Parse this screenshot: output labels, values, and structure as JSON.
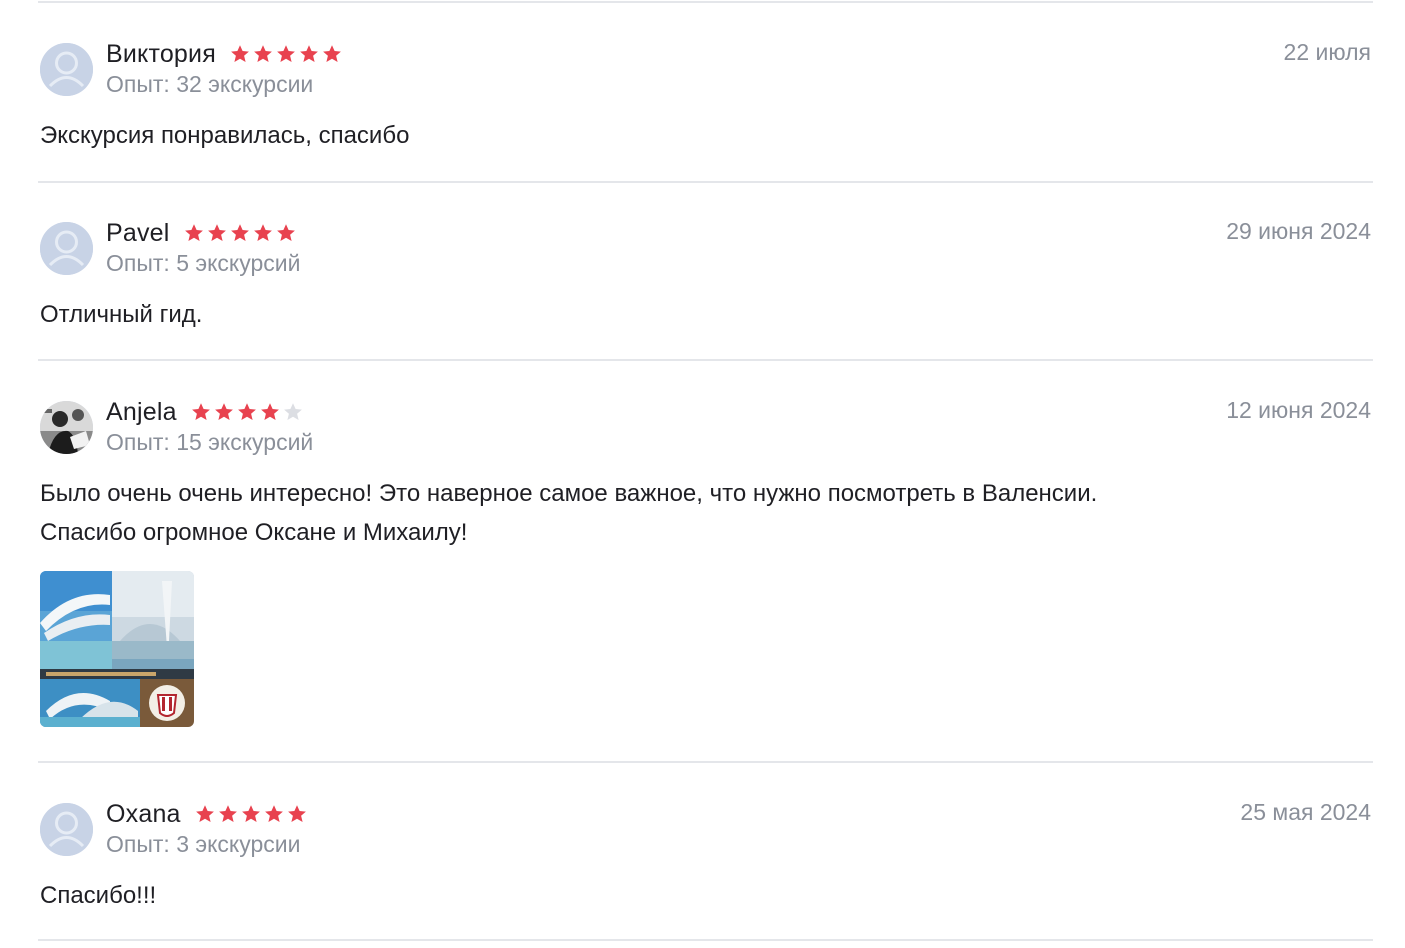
{
  "colors": {
    "star_filled": "#e8424f",
    "star_empty": "#dcdee3",
    "muted_text": "#8a8f99",
    "divider": "#e4e6ea",
    "avatar_placeholder": "#c8d3e6"
  },
  "reviews": [
    {
      "name": "Виктория",
      "rating": 5,
      "experience": "Опыт: 32 экскурсии",
      "date": "22 июля",
      "text": "Экскурсия понравилась, спасибо",
      "avatar": "default-user-icon"
    },
    {
      "name": "Pavel",
      "rating": 5,
      "experience": "Опыт: 5 экскурсий",
      "date": "29 июня 2024",
      "text": "Отличный гид.",
      "avatar": "default-user-icon"
    },
    {
      "name": "Anjela",
      "rating": 4,
      "experience": "Опыт: 15 экскурсий",
      "date": "12 июня 2024",
      "text_line1": "Было очень очень интересно! Это наверное самое важное, что нужно посмотреть в Валенсии.",
      "text_line2": "Спасибо огромное Оксане и Михаилу!",
      "avatar": "user-photo",
      "photo": "valencia-collage-image"
    },
    {
      "name": "Oxana",
      "rating": 5,
      "experience": "Опыт: 3 экскурсии",
      "date": "25 мая 2024",
      "text": "Спасибо!!!",
      "avatar": "default-user-icon"
    }
  ]
}
